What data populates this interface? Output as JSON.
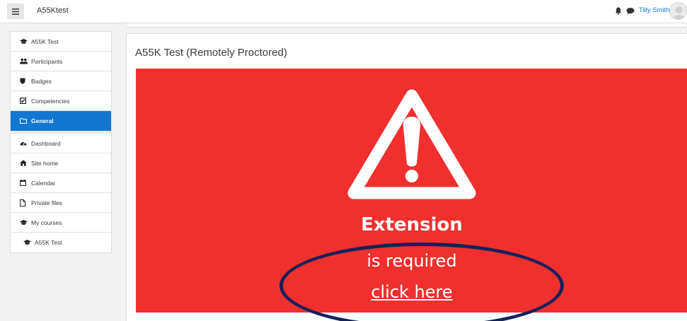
{
  "header": {
    "site_name": "A55Ktest",
    "user_name": "Tilly Smith",
    "icons": [
      "menu-icon",
      "bell-icon",
      "chat-icon",
      "avatar"
    ]
  },
  "sidebar": {
    "course_group": [
      {
        "label": "A55K Test",
        "icon": "graduation-cap-icon"
      },
      {
        "label": "Participants",
        "icon": "users-icon"
      },
      {
        "label": "Badges",
        "icon": "shield-icon"
      },
      {
        "label": "Competencies",
        "icon": "checkbox-icon"
      },
      {
        "label": "General",
        "icon": "folder-icon",
        "active": true
      }
    ],
    "site_group": [
      {
        "label": "Dashboard",
        "icon": "dashboard-icon"
      },
      {
        "label": "Site home",
        "icon": "home-icon"
      },
      {
        "label": "Calendar",
        "icon": "calendar-icon"
      },
      {
        "label": "Private files",
        "icon": "file-icon"
      },
      {
        "label": "My courses",
        "icon": "graduation-cap-icon"
      },
      {
        "label": "A55K Test",
        "icon": "graduation-cap-icon"
      }
    ]
  },
  "main": {
    "page_title": "A55K Test (Remotely Proctored)",
    "banner": {
      "title": "Extension",
      "subtitle": "is required",
      "link_text": "click here",
      "background": "#f0302e"
    }
  },
  "colors": {
    "accent": "#1177d1",
    "ellipse": "#14215a"
  }
}
